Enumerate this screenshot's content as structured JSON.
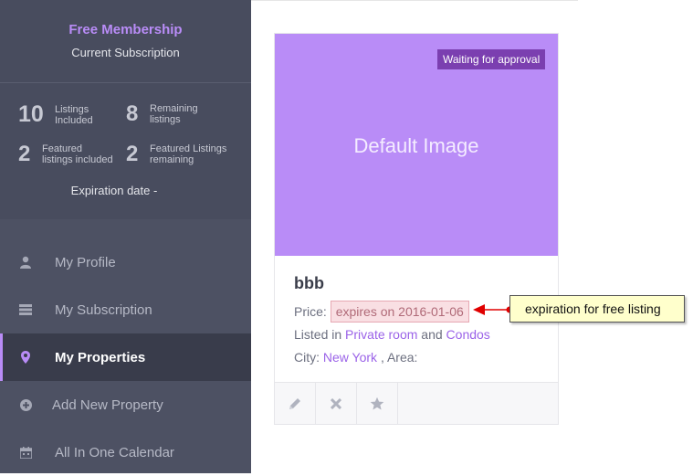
{
  "subscription": {
    "title": "Free Membership",
    "current": "Current Subscription",
    "listings_included": {
      "num": "10",
      "label_1": "Listings",
      "label_2": "Included"
    },
    "remaining_listings": {
      "num": "8",
      "label_1": "Remaining",
      "label_2": "listings"
    },
    "featured_included": {
      "num": "2",
      "label_1": "Featured",
      "label_2": "listings included"
    },
    "featured_remaining": {
      "num": "2",
      "label_1": "Featured Listings",
      "label_2": "remaining"
    },
    "expiration": "Expiration date -"
  },
  "menu": [
    {
      "label": "My Profile",
      "icon": "user-icon"
    },
    {
      "label": "My Subscription",
      "icon": "list-icon"
    },
    {
      "label": "My Properties",
      "icon": "map-pin-icon",
      "active": true
    },
    {
      "label": "Add New Property",
      "icon": "plus-circle-icon"
    },
    {
      "label": "All In One Calendar",
      "icon": "calendar-icon"
    }
  ],
  "property": {
    "image_text": "Default Image",
    "badge": "Waiting for approval",
    "title": "bbb",
    "price_label": "Price:",
    "price_value": "expires on 2016-01-06",
    "listed_prefix": "Listed in",
    "category": "Private room",
    "and": "and",
    "type": "Condos",
    "city_label": "City:",
    "city": "New York",
    "area_label": ", Area:"
  },
  "annotation": {
    "text": "expiration for free listing"
  },
  "colors": {
    "accent": "#b98cf7",
    "sidebar": "#4d5163",
    "annotation_arrow": "#e00000"
  }
}
